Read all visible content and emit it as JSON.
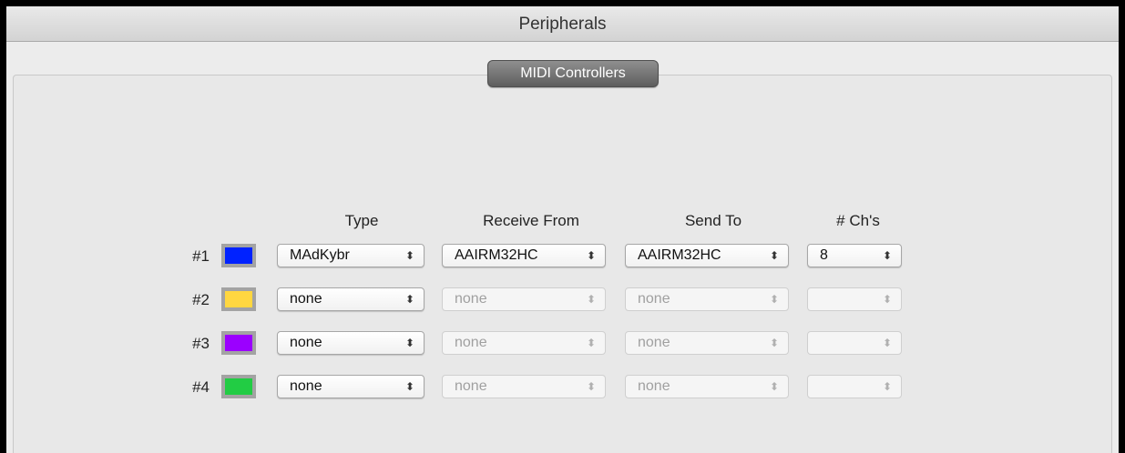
{
  "window": {
    "title": "Peripherals"
  },
  "tab": {
    "label": "MIDI Controllers"
  },
  "columns": {
    "type": "Type",
    "receive_from": "Receive From",
    "send_to": "Send To",
    "channels": "# Ch's"
  },
  "arrows_glyph": "⬍",
  "rows": [
    {
      "label": "#1",
      "color": "#0022ff",
      "type": "MAdKybr",
      "receive_from": "AAIRM32HC",
      "send_to": "AAIRM32HC",
      "channels": "8"
    },
    {
      "label": "#2",
      "color": "#ffd740",
      "type": "none",
      "receive_from": "none",
      "send_to": "none",
      "channels": ""
    },
    {
      "label": "#3",
      "color": "#9b00ff",
      "type": "none",
      "receive_from": "none",
      "send_to": "none",
      "channels": ""
    },
    {
      "label": "#4",
      "color": "#22cc44",
      "type": "none",
      "receive_from": "none",
      "send_to": "none",
      "channels": ""
    }
  ]
}
